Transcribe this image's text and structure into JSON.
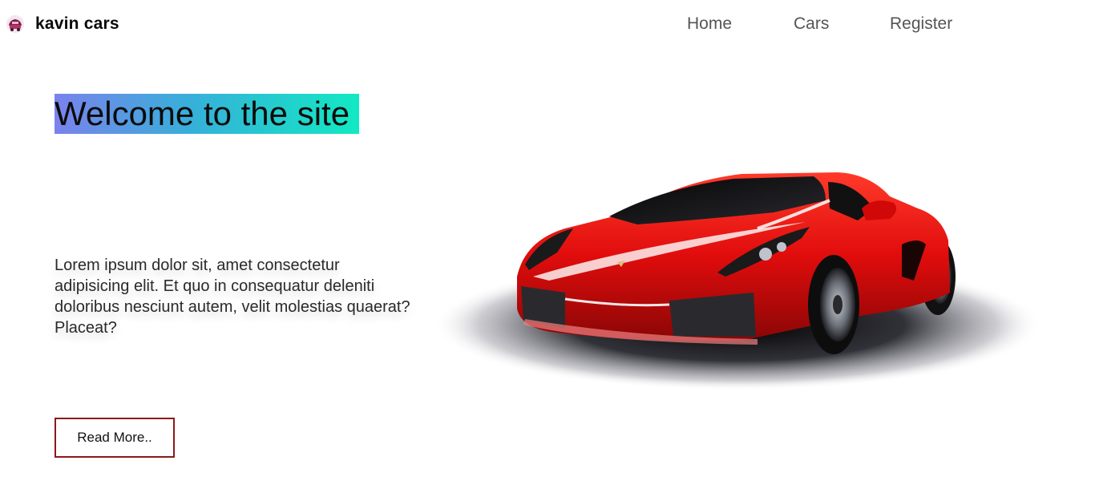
{
  "header": {
    "brand_name": "kavin cars",
    "logo_icon": "car-logo-icon",
    "nav": [
      {
        "label": "Home"
      },
      {
        "label": "Cars"
      },
      {
        "label": "Register"
      }
    ]
  },
  "hero": {
    "title": "Welcome to the site",
    "text": "Lorem ipsum dolor sit, amet consectetur adipisicing elit. Et quo in consequatur deleniti doloribus nesciunt autem, velit molestias quaerat? Placeat?",
    "read_more_label": "Read More..",
    "image": "red-sports-car-image"
  },
  "colors": {
    "title_gradient_start": "#7a82ec",
    "title_gradient_end": "#12e9c3",
    "button_border": "#8b1a1a",
    "car_red": "#e01010"
  }
}
